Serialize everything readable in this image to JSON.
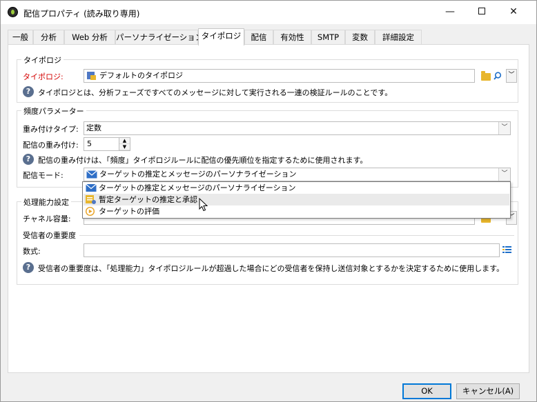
{
  "window": {
    "title": "配信プロパティ (読み取り専用)",
    "controls": {
      "minimize": "—",
      "close": "✕"
    }
  },
  "tabs": [
    {
      "label": "一般"
    },
    {
      "label": "分析"
    },
    {
      "label": "Web 分析"
    },
    {
      "label": "パーソナライゼーション"
    },
    {
      "label": "タイポロジ",
      "active": true
    },
    {
      "label": "配信"
    },
    {
      "label": "有効性"
    },
    {
      "label": "SMTP"
    },
    {
      "label": "変数"
    },
    {
      "label": "詳細設定"
    }
  ],
  "typology_group": {
    "legend": "タイポロジ",
    "typology_label": "タイポロジ:",
    "typology_value": "デフォルトのタイポロジ",
    "help": "タイポロジとは、分析フェーズですべてのメッセージに対して実行される一連の検証ルールのことです。"
  },
  "frequency_group": {
    "legend": "頻度パラメーター",
    "weight_type_label": "重み付けタイプ:",
    "weight_type_value": "定数",
    "weight_label": "配信の重み付け:",
    "weight_value": "5",
    "help": "配信の重み付けは、「頻度」タイポロジルールに配信の優先順位を指定するために使用されます。",
    "mode_label": "配信モード:",
    "mode_value": "ターゲットの推定とメッセージのパーソナライゼーション"
  },
  "mode_dropdown": {
    "options": [
      {
        "label": "ターゲットの推定とメッセージのパーソナライゼーション",
        "icon": "envelope-icon"
      },
      {
        "label": "暫定ターゲットの推定と承認",
        "icon": "approval-icon",
        "hover": true
      },
      {
        "label": "ターゲットの評価",
        "icon": "play-circle-icon"
      }
    ]
  },
  "capacity_group": {
    "legend": "処理能力設定",
    "channel_capacity_label": "チャネル容量:",
    "recipient_importance_heading": "受信者の重要度",
    "formula_label": "数式:",
    "formula_value": "",
    "help": "受信者の重要度は、「処理能力」タイポロジルールが超過した場合にどの受信者を保持し送信対象とするかを決定するために使用します。"
  },
  "footer": {
    "ok_label": "OK",
    "cancel_label": "キャンセル(A)"
  },
  "colors": {
    "required_label": "#d40000",
    "accent": "#0078d7",
    "help_icon": "#5a6f8f",
    "folder": "#e8b62c"
  }
}
